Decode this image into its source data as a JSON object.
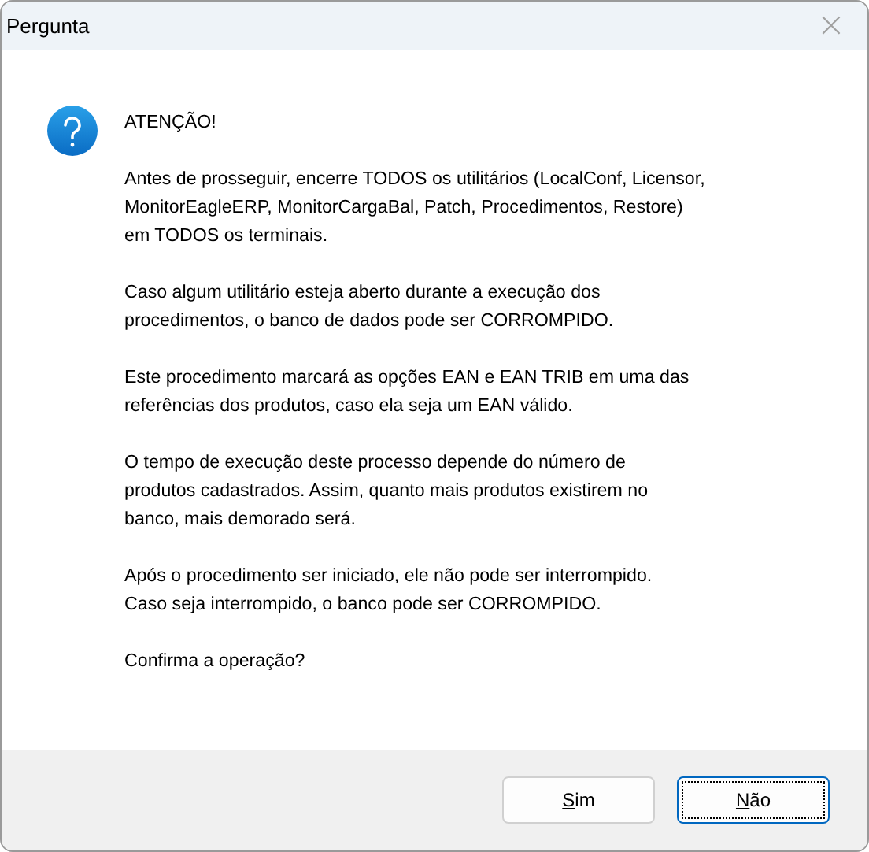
{
  "window": {
    "title": "Pergunta",
    "close": "×"
  },
  "message": {
    "heading": "ATENÇÃO!",
    "paragraphs": [
      "Antes de prosseguir, encerre TODOS os utilitários (LocalConf, Licensor,\nMonitorEagleERP, MonitorCargaBal, Patch, Procedimentos, Restore)\nem TODOS os terminais.",
      "Caso algum utilitário esteja aberto durante a execução dos\nprocedimentos, o banco de dados pode ser CORROMPIDO.",
      "Este procedimento marcará as opções EAN e EAN TRIB em uma das\nreferências dos produtos, caso ela seja um EAN válido.",
      "O tempo de execução deste processo depende do número de\nprodutos cadastrados. Assim, quanto mais produtos existirem no\nbanco, mais demorado será.",
      "Após o procedimento ser iniciado, ele não pode ser interrompido.\nCaso seja interrompido, o banco pode ser CORROMPIDO.",
      "Confirma a operação?"
    ]
  },
  "buttons": [
    {
      "label": "Sim",
      "mnemonic": true,
      "default": false
    },
    {
      "label": "Não",
      "mnemonic": true,
      "default": true
    }
  ]
}
